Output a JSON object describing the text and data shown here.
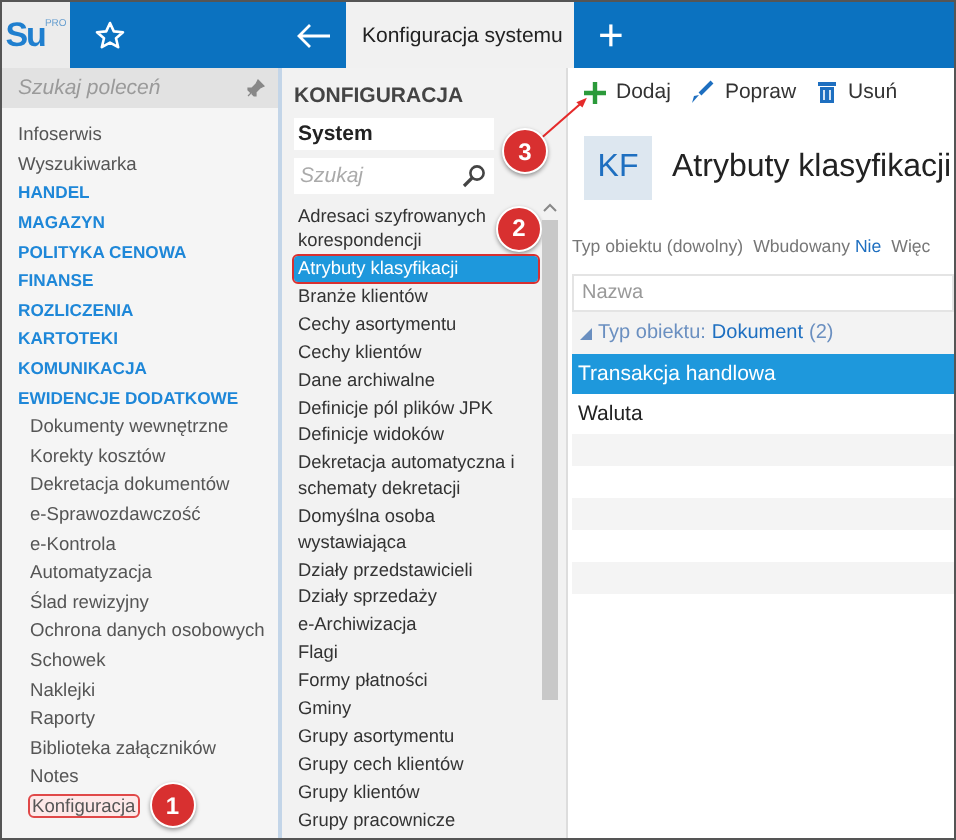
{
  "logo": {
    "text": "Su",
    "superscript": "PRO"
  },
  "tabs": [
    {
      "label": "Konfiguracja systemu",
      "selected": true
    }
  ],
  "add_tab": "+",
  "sidebar": {
    "search": {
      "placeholder": "Szukaj poleceń"
    },
    "items": [
      {
        "label": "Infoserwis",
        "kind": "link",
        "selected": false
      },
      {
        "label": "Wyszukiwarka",
        "kind": "link",
        "selected": false
      },
      {
        "label": "HANDEL",
        "kind": "section",
        "selected": false
      },
      {
        "label": "MAGAZYN",
        "kind": "section",
        "selected": false
      },
      {
        "label": "POLITYKA CENOWA",
        "kind": "section",
        "selected": false
      },
      {
        "label": "FINANSE",
        "kind": "section",
        "selected": false
      },
      {
        "label": "ROZLICZENIA",
        "kind": "section",
        "selected": false
      },
      {
        "label": "KARTOTEKI",
        "kind": "section",
        "selected": false
      },
      {
        "label": "KOMUNIKACJA",
        "kind": "section",
        "selected": false
      },
      {
        "label": "EWIDENCJE DODATKOWE",
        "kind": "section",
        "selected": false
      },
      {
        "label": "Dokumenty wewnętrzne",
        "kind": "sub",
        "selected": false
      },
      {
        "label": "Korekty kosztów",
        "kind": "sub",
        "selected": false
      },
      {
        "label": "Dekretacja dokumentów",
        "kind": "sub",
        "selected": false
      },
      {
        "label": "e-Sprawozdawczość",
        "kind": "sub",
        "selected": false
      },
      {
        "label": "e-Kontrola",
        "kind": "sub",
        "selected": false
      },
      {
        "label": "Automatyzacja",
        "kind": "sub",
        "selected": false
      },
      {
        "label": "Ślad rewizyjny",
        "kind": "sub",
        "selected": false
      },
      {
        "label": "Ochrona danych osobowych",
        "kind": "sub",
        "selected": false
      },
      {
        "label": "Schowek",
        "kind": "sub",
        "selected": false
      },
      {
        "label": "Naklejki",
        "kind": "sub",
        "selected": false
      },
      {
        "label": "Raporty",
        "kind": "sub",
        "selected": false
      },
      {
        "label": "Biblioteka załączników",
        "kind": "sub",
        "selected": false
      },
      {
        "label": "Notes",
        "kind": "sub",
        "selected": false
      },
      {
        "label": "Konfiguracja",
        "kind": "sub",
        "selected": true,
        "callout": "1"
      }
    ]
  },
  "config": {
    "title": "KONFIGURACJA",
    "dropdown": "System",
    "search": {
      "placeholder": "Szukaj"
    },
    "items": [
      {
        "label": "Adresaci szyfrowanych korespondencji",
        "selected": false,
        "callout": "2"
      },
      {
        "label": "Atrybuty klasyfikacji",
        "selected": true
      },
      {
        "label": "Branże klientów",
        "selected": false
      },
      {
        "label": "Cechy asortymentu",
        "selected": false
      },
      {
        "label": "Cechy klientów",
        "selected": false
      },
      {
        "label": "Dane archiwalne",
        "selected": false
      },
      {
        "label": "Definicje pól plików JPK",
        "selected": false
      },
      {
        "label": "Definicje widoków",
        "selected": false
      },
      {
        "label": "Dekretacja automatyczna i schematy dekretacji",
        "selected": false
      },
      {
        "label": "Domyślna osoba wystawiająca",
        "selected": false
      },
      {
        "label": "Działy przedstawicieli",
        "selected": false
      },
      {
        "label": "Działy sprzedaży",
        "selected": false
      },
      {
        "label": "e-Archiwizacja",
        "selected": false
      },
      {
        "label": "Flagi",
        "selected": false
      },
      {
        "label": "Formy płatności",
        "selected": false
      },
      {
        "label": "Gminy",
        "selected": false
      },
      {
        "label": "Grupy asortymentu",
        "selected": false
      },
      {
        "label": "Grupy cech klientów",
        "selected": false
      },
      {
        "label": "Grupy klientów",
        "selected": false
      },
      {
        "label": "Grupy pracownicze",
        "selected": false
      }
    ]
  },
  "toolbar": [
    {
      "label": "Dodaj",
      "kind": "add",
      "callout": "3"
    },
    {
      "label": "Popraw",
      "kind": "edit"
    },
    {
      "label": "Usuń",
      "kind": "delete"
    }
  ],
  "header": {
    "badge": "KF",
    "title": "Atrybuty klasyfikacji"
  },
  "filters": [
    {
      "label": "Typ obiektu (dowolny)"
    },
    {
      "label": "Wbudowany",
      "value": "Nie"
    },
    {
      "label": "Więc"
    }
  ],
  "table": {
    "columns": [
      "Nazwa"
    ],
    "groups": [
      {
        "label": "Typ obiektu:",
        "value": "Dokument",
        "count": "(2)",
        "expanded": true,
        "rows": [
          {
            "name": "Transakcja handlowa",
            "selected": true
          },
          {
            "name": "Waluta",
            "selected": false
          }
        ]
      }
    ]
  }
}
